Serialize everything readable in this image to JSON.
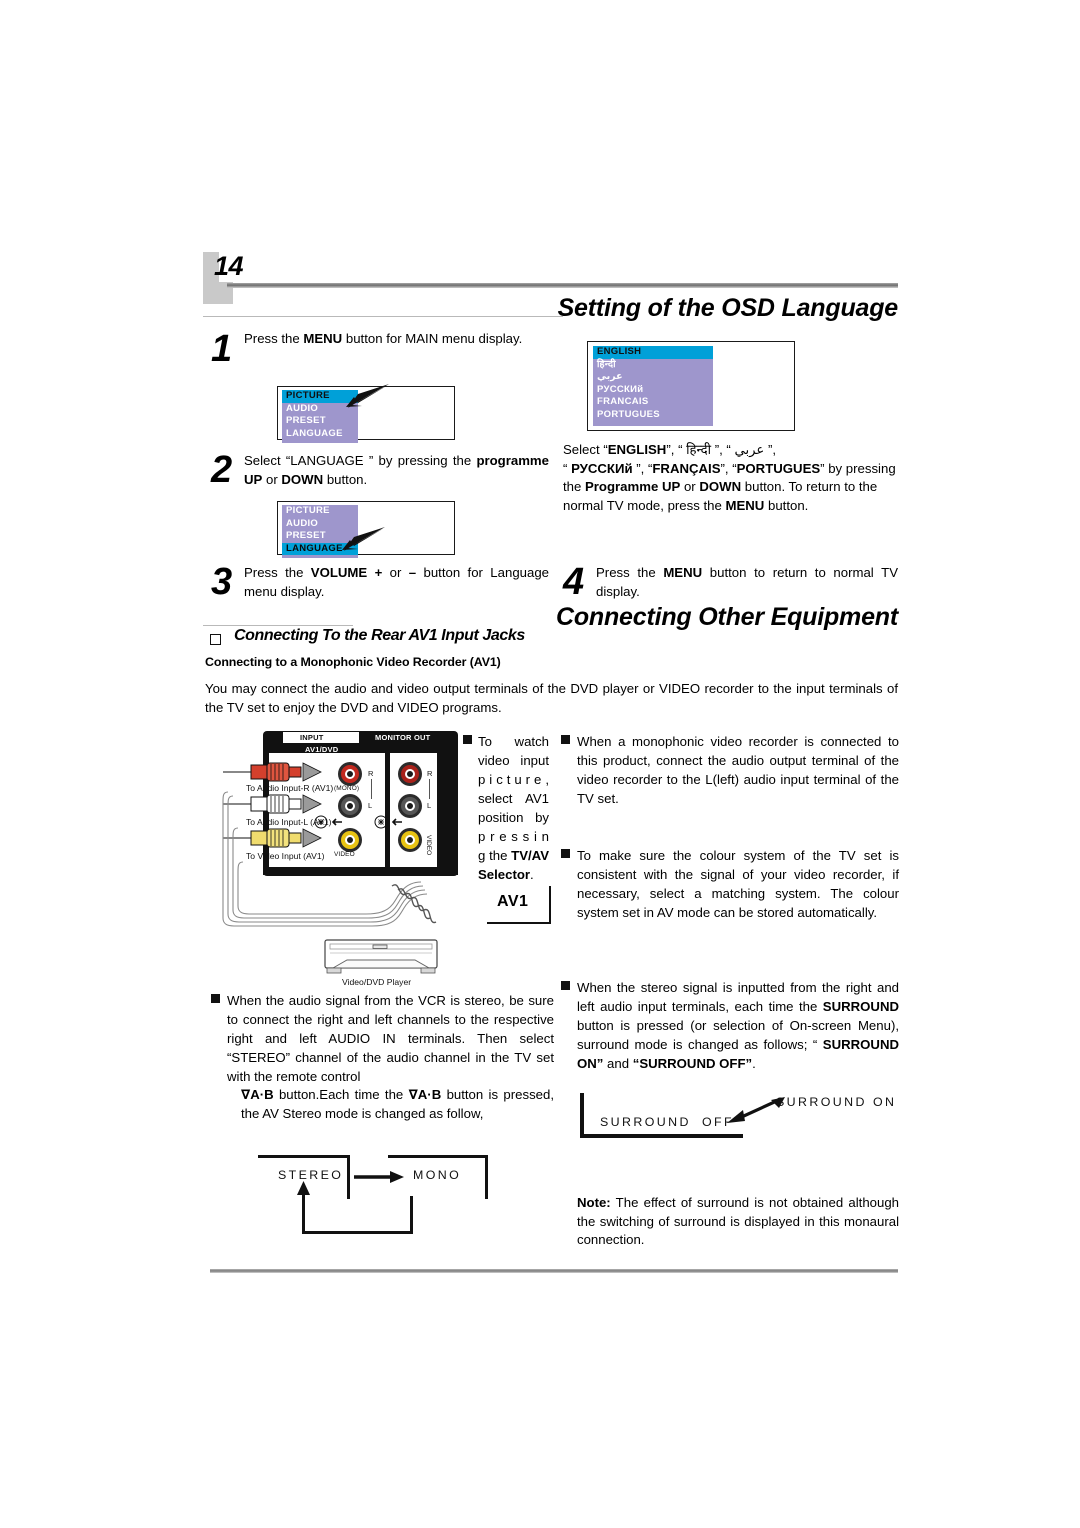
{
  "page": {
    "number": "14"
  },
  "sections": {
    "osd_language": "Setting of the OSD Language",
    "connecting_other": "Connecting Other Equipment",
    "rear_av1": "Connecting To the Rear AV1 Input Jacks",
    "monophonic": "Connecting to a Monophonic Video Recorder (AV1)"
  },
  "steps": {
    "s1": {
      "num": "1",
      "text_a": "Press the ",
      "bold_a": "MENU",
      "text_b": " button for MAIN menu display."
    },
    "s2": {
      "num": "2",
      "text_a": "Select “LANGUAGE ” by pressing the ",
      "bold_a": "programme UP",
      "text_b": " or ",
      "bold_b": "DOWN",
      "text_c": " button."
    },
    "s3": {
      "num": "3",
      "text_a": "Press the ",
      "bold_a": "VOLUME +",
      "text_b": " or ",
      "bold_b": "–",
      "text_c": " button for Language menu display."
    },
    "s4": {
      "num": "4",
      "text_a": "Press the ",
      "bold_a": "MENU",
      "text_b": " button to return to normal TV display."
    }
  },
  "lang_select": {
    "l1": "Select “",
    "b1": "ENGLISH",
    "l2": "”, “ हिन्दी ”, “ عربي ”,",
    "l3": "“ ",
    "b2": "РУССКИй",
    "l4": " ”, “",
    "b3": "FRANÇAIS",
    "l5": "”, “",
    "b4": "PORTUGUES",
    "l6": "”  by pressing the  ",
    "b5": "Programme UP",
    "l7": " or ",
    "b6": "DOWN",
    "l8": " button. To return to the normal TV mode, press the ",
    "b7": "MENU",
    "l9": " button."
  },
  "osd_main": {
    "rows": [
      "PICTURE",
      "AUDIO",
      "PRESET",
      "LANGUAGE"
    ],
    "selected_1": "PICTURE",
    "selected_2": "LANGUAGE",
    "bg": "#9e96cc",
    "highlight": "#00a0d8"
  },
  "osd_lang": {
    "rows": [
      "ENGLISH",
      "हिन्दी",
      "عربي",
      "РУССКИй",
      "FRANCAIS",
      "PORTUGUES"
    ],
    "selected": "ENGLISH"
  },
  "intro_para": "You may connect the audio and video output terminals of the DVD player or VIDEO recorder to the input terminals of the TV set to enjoy the DVD and VIDEO programs.",
  "connector": {
    "input": "INPUT",
    "monitor_out": "MONITOR OUT",
    "av1_dvd": "AV1/DVD",
    "jack_r": "R",
    "jack_l": "L",
    "mono": "(MONO)",
    "video": "VIDEO",
    "video_vert": "VIDEO",
    "cable_r": "To Audio Input-R (AV1)",
    "cable_l": "To Audio Input-L (AV1)",
    "cable_v": "To Video Input (AV1)",
    "av1_tag": "AV1",
    "player_caption": "Video/DVD Player",
    "colors": {
      "r_jack": "#c1281e",
      "l_jack": "#3a3a3a",
      "v_jack": "#e8c313",
      "panel": "#111111"
    }
  },
  "bullets": {
    "b_towatch": {
      "t1": "To watch video input p i c t u r e , select AV1 position by p r e s s i n g the ",
      "bold1": "TV/AV Selector",
      "t2": "."
    },
    "b_mono": "When a monophonic video recorder is connected to this product, connect the audio output terminal of the video recorder to the L(left) audio input terminal of the TV set.",
    "b_colour": "To make sure the colour system of the TV set is consistent with the signal of your video recorder, if necessary,  select a matching system. The colour system set in AV mode can be stored automatically.",
    "b_vcr": "When the audio signal from the VCR is stereo, be sure to connect the right and left channels to the respective right and left AUDIO IN terminals. Then select “STEREO” channel of the audio channel in the TV set with the remote control",
    "b_vcr2_a": "∇A·B",
    "b_vcr2_b": " button.Each time the ",
    "b_vcr2_c": "∇A·B",
    "b_vcr2_d": "  button is pressed, the AV Stereo mode is changed as follow,",
    "b_surround": {
      "t1": "When the stereo signal is inputted from the right and left audio input terminals, each time the ",
      "bold1": "SURROUND",
      "t2": " button is pressed (or selection of On-screen Menu), surround mode is changed as follows; “ ",
      "bold2": "SURROUND ON”",
      "t3": " and ",
      "bold3": "“SURROUND OFF”",
      "t4": "."
    }
  },
  "stereo_diagram": {
    "left": "STEREO",
    "right": "MONO"
  },
  "surround_diagram": {
    "off_a": "SURROUND",
    "off_b": "OFF",
    "on_a": "SURROUND",
    "on_b": "ON"
  },
  "note": {
    "label": "Note:",
    "text": " The effect of surround is not obtained although the switching of surround is displayed in this monaural connection."
  }
}
